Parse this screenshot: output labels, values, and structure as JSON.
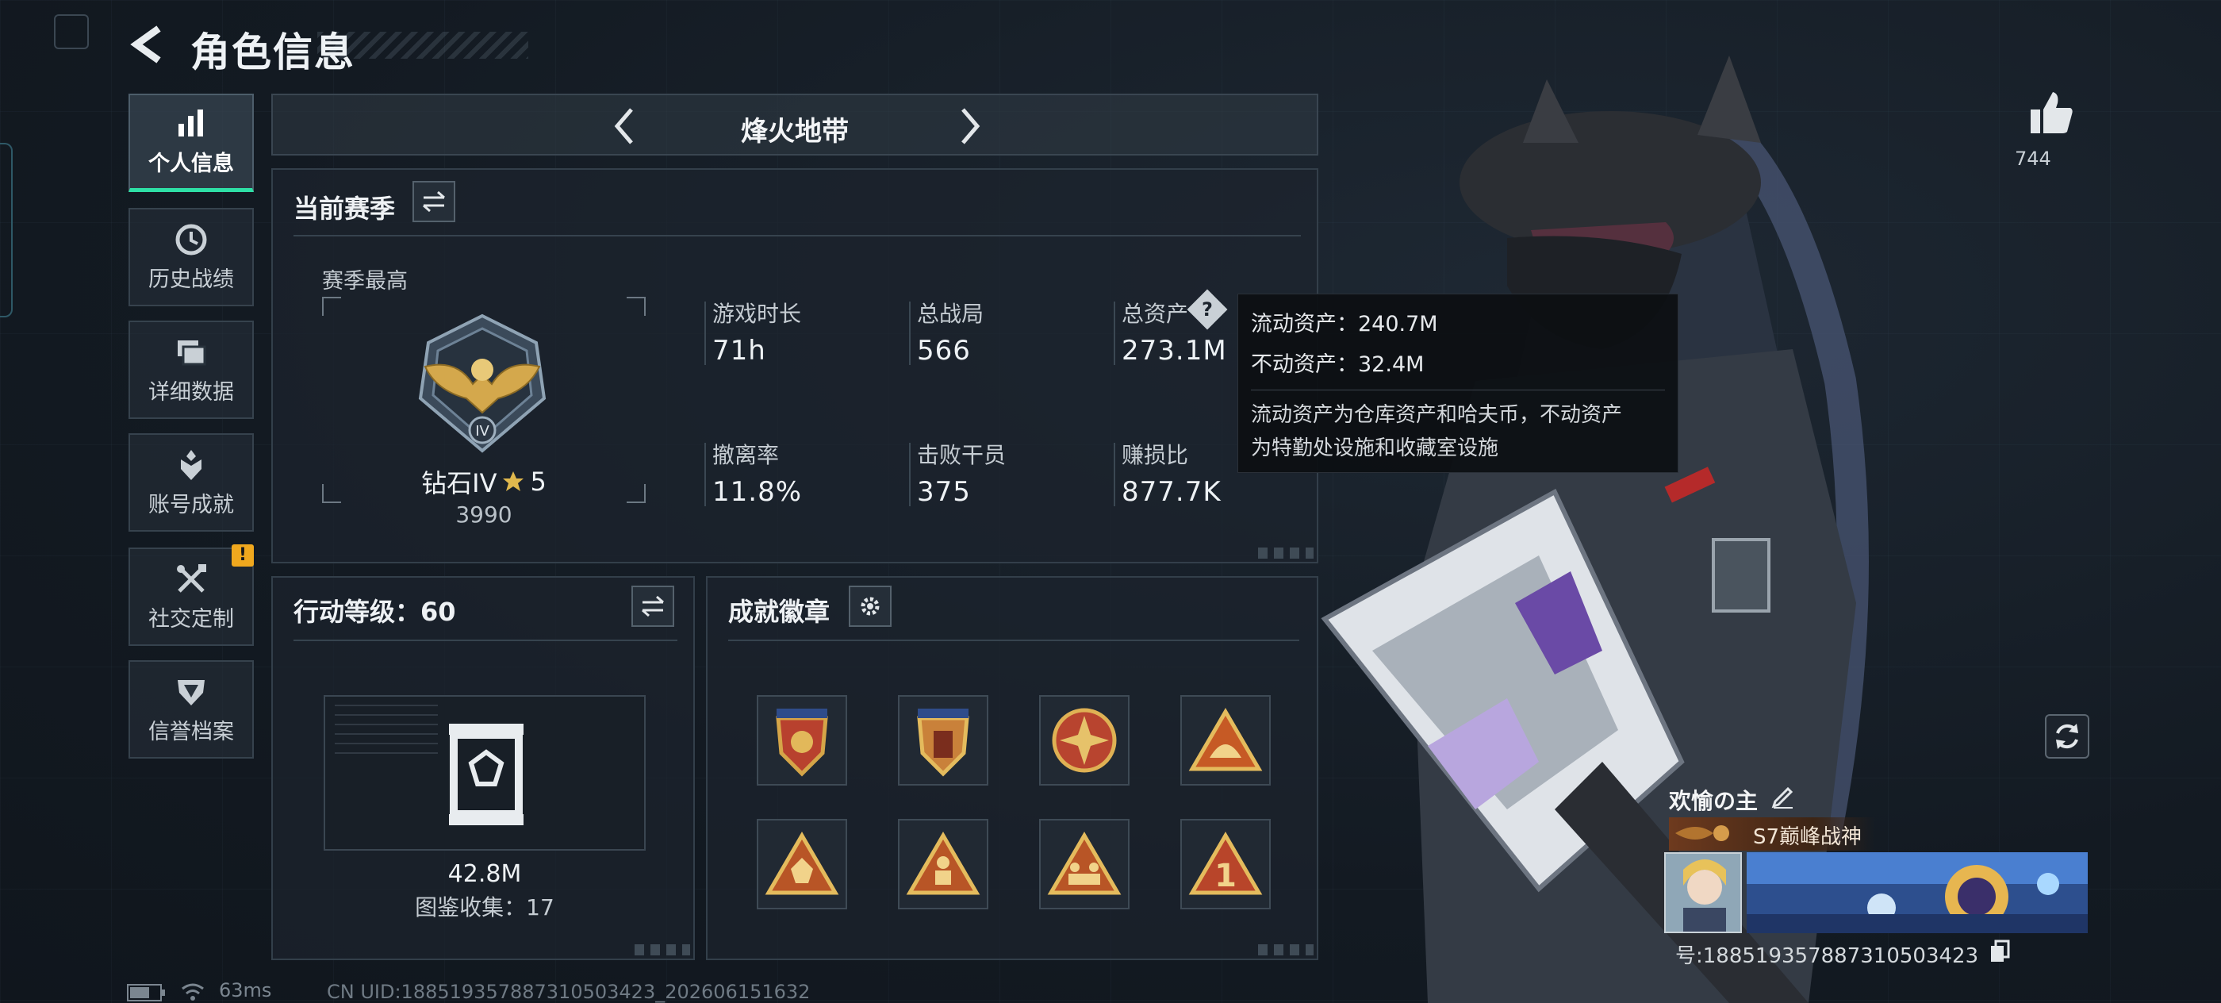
{
  "header": {
    "title": "角色信息"
  },
  "sidebar": {
    "items": [
      {
        "label": "个人信息",
        "icon": "bar-chart-icon",
        "active": true
      },
      {
        "label": "历史战绩",
        "icon": "clock-icon"
      },
      {
        "label": "详细数据",
        "icon": "files-icon"
      },
      {
        "label": "账号成就",
        "icon": "medal-icon"
      },
      {
        "label": "社交定制",
        "icon": "tools-icon",
        "alert": "!"
      },
      {
        "label": "信誉档案",
        "icon": "shield-icon"
      }
    ]
  },
  "mode": {
    "name": "烽火地带"
  },
  "season": {
    "title": "当前赛季",
    "best_label": "赛季最高",
    "rank_name": "钻石IV",
    "rank_stars": "5",
    "rank_score": "3990",
    "stats": [
      {
        "label": "游戏时长",
        "value": "71h"
      },
      {
        "label": "总战局",
        "value": "566"
      },
      {
        "label": "总资产",
        "value": "273.1M",
        "help": "?"
      },
      {
        "label": "撤离率",
        "value": "11.8%"
      },
      {
        "label": "击败干员",
        "value": "375"
      },
      {
        "label": "赚损比",
        "value": "877.7K"
      }
    ]
  },
  "tooltip": {
    "line1": "流动资产：240.7M",
    "line2": "不动资产：32.4M",
    "desc1": "流动资产为仓库资产和哈夫币，不动资产",
    "desc2": "为特勤处设施和收藏室设施"
  },
  "action_level": {
    "title": "行动等级：60",
    "value": "42.8M",
    "collection": "图鉴收集：17"
  },
  "achievements": {
    "title": "成就徽章",
    "badges": [
      "badge-shield-red-stars",
      "badge-shield-gold-stars",
      "badge-star-compass",
      "badge-triangle-helmet",
      "badge-triangle-crystal",
      "badge-triangle-soldier",
      "badge-triangle-squad",
      "badge-triangle-one"
    ]
  },
  "profile": {
    "like_count": "744",
    "player_name": "欢愉の主",
    "player_title": "S7巅峰战神",
    "uid": "号:188519357887310503423"
  },
  "status": {
    "ping": "63ms",
    "cn_uid": "CN UID:188519357887310503423_202606151632"
  },
  "colors": {
    "accent": "#2ee0a6",
    "warning": "#f0a81e",
    "panel_border": "#333f4a"
  }
}
